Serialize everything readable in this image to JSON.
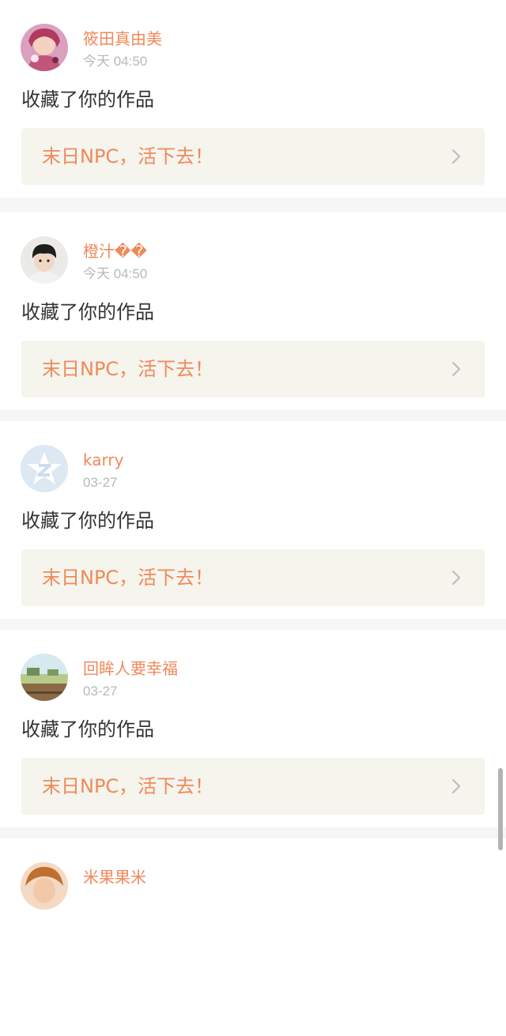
{
  "notifications": [
    {
      "username": "筱田真由美",
      "timestamp": "今天 04:50",
      "action": "收藏了你的作品",
      "work_title": "末日NPC，活下去！",
      "avatar": "anime-girl-avatar"
    },
    {
      "username": "橙汁��",
      "timestamp": "今天 04:50",
      "action": "收藏了你的作品",
      "work_title": "末日NPC，活下去！",
      "avatar": "young-man-avatar"
    },
    {
      "username": "karry",
      "timestamp": "03-27",
      "action": "收藏了你的作品",
      "work_title": "末日NPC，活下去！",
      "avatar": "default-star-avatar"
    },
    {
      "username": "回眸人要幸福",
      "timestamp": "03-27",
      "action": "收藏了你的作品",
      "work_title": "末日NPC，活下去！",
      "avatar": "landscape-avatar"
    },
    {
      "username": "米果果米",
      "avatar": "partial-avatar"
    }
  ],
  "icons": {
    "chevron": "chevron-right-icon"
  },
  "colors": {
    "accent": "#f0895a",
    "text": "#333333",
    "muted": "#b8b8b8",
    "link_bg": "#f5f4ed",
    "page_bg": "#f6f6f4"
  }
}
